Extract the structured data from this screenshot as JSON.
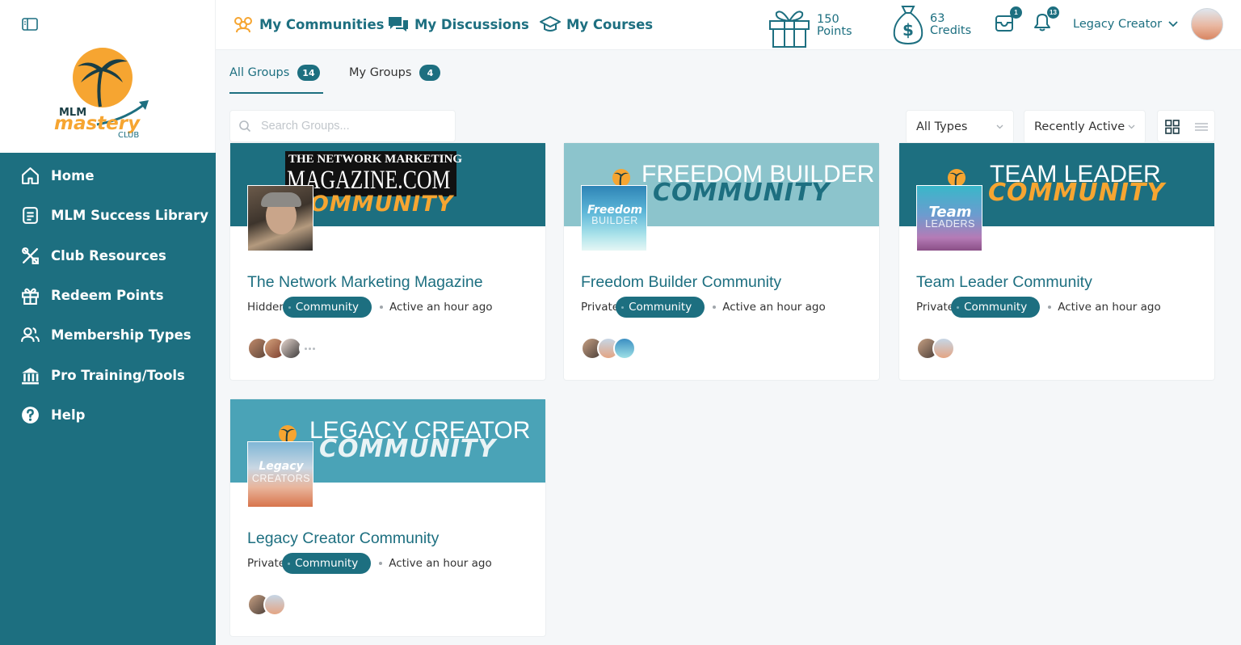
{
  "sidebar": {
    "logo": {
      "line1": "MLM",
      "line2": "mastery",
      "line3": "CLUB"
    },
    "items": [
      {
        "label": "Home",
        "icon": "home-icon"
      },
      {
        "label": "MLM Success Library",
        "icon": "document-icon"
      },
      {
        "label": "Club Resources",
        "icon": "tools-icon"
      },
      {
        "label": "Redeem Points",
        "icon": "gift-icon"
      },
      {
        "label": "Membership Types",
        "icon": "users-icon"
      },
      {
        "label": "Pro Training/Tools",
        "icon": "bank-icon"
      },
      {
        "label": "Help",
        "icon": "help-icon"
      }
    ]
  },
  "topbar": {
    "links": [
      {
        "label": "My Communities",
        "icon": "communities-icon"
      },
      {
        "label": "My Discussions",
        "icon": "discussions-icon"
      },
      {
        "label": "My Courses",
        "icon": "graduation-cap-icon"
      }
    ],
    "points": {
      "value": "150",
      "label": "Points"
    },
    "credits": {
      "value": "63",
      "label": "Credits"
    },
    "messages_count": "1",
    "notifications_count": "13",
    "user_name": "Legacy Creator"
  },
  "tabs": [
    {
      "label": "All Groups",
      "count": "14",
      "active": true
    },
    {
      "label": "My Groups",
      "count": "4",
      "active": false
    }
  ],
  "filters": {
    "search_placeholder": "Search Groups...",
    "type_select": "All Types",
    "order_select": "Recently Active"
  },
  "colors": {
    "primary": "#1d6f80",
    "accent": "#f6a531",
    "light_teal": "#8cc4cc",
    "mid_teal": "#4aa3b7"
  },
  "groups": [
    {
      "cover_line1": "THE NETWORK MARKETING",
      "cover_line2": "MAGAZINE.COM",
      "cover_line3": "COMMUNITY",
      "title": "The Network Marketing Magazine",
      "privacy": "Hidden",
      "type": "Community",
      "activity": "Active an hour ago"
    },
    {
      "cover_line1": "FREEDOM BUILDER",
      "cover_line2": "COMMUNITY",
      "thumb_line1": "Freedom",
      "thumb_line2": "BUILDER",
      "title": "Freedom Builder Community",
      "privacy": "Private",
      "type": "Community",
      "activity": "Active an hour ago"
    },
    {
      "cover_line1": "TEAM LEADER",
      "cover_line2": "COMMUNITY",
      "thumb_line1": "Team",
      "thumb_line2": "LEADERS",
      "title": "Team Leader Community",
      "privacy": "Private",
      "type": "Community",
      "activity": "Active an hour ago"
    },
    {
      "cover_line1": "LEGACY CREATOR",
      "cover_line2": "COMMUNITY",
      "thumb_line1": "Legacy",
      "thumb_line2": "CREATORS",
      "title": "Legacy Creator Community",
      "privacy": "Private",
      "type": "Community",
      "activity": "Active an hour ago"
    }
  ]
}
